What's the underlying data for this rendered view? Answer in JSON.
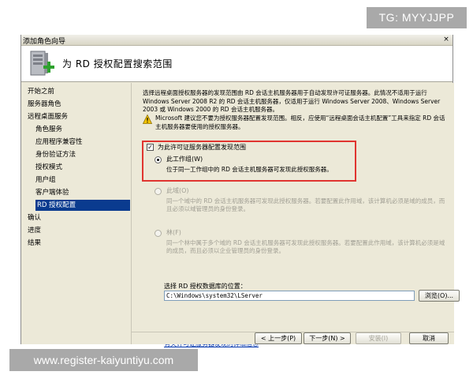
{
  "window": {
    "title": "添加角色向导",
    "close_glyph": "×"
  },
  "header": {
    "title": "为 RD 授权配置搜索范围",
    "icon": "server-add-icon"
  },
  "sidebar": {
    "items": [
      {
        "label": "开始之前",
        "level": 0,
        "active": false
      },
      {
        "label": "服务器角色",
        "level": 0,
        "active": false
      },
      {
        "label": "远程桌面服务",
        "level": 0,
        "active": false
      },
      {
        "label": "角色服务",
        "level": 1,
        "active": false
      },
      {
        "label": "应用程序兼容性",
        "level": 1,
        "active": false
      },
      {
        "label": "身份验证方法",
        "level": 1,
        "active": false
      },
      {
        "label": "授权模式",
        "level": 1,
        "active": false
      },
      {
        "label": "用户组",
        "level": 1,
        "active": false
      },
      {
        "label": "客户端体验",
        "level": 1,
        "active": false
      },
      {
        "label": "RD 授权配置",
        "level": 1,
        "active": true
      },
      {
        "label": "确认",
        "level": 0,
        "active": false
      },
      {
        "label": "进度",
        "level": 0,
        "active": false
      },
      {
        "label": "结果",
        "level": 0,
        "active": false
      }
    ]
  },
  "main": {
    "intro": "选择远程桌面授权服务器的发现范围由 RD 会话主机服务器用于自动发现许可证服务器。此情况不适用于运行 Windows Server 2008 R2 的 RD 会话主机服务器，仅适用于运行 Windows Server 2008、Windows Server 2003 或 Windows 2000 的 RD 会话主机服务器。",
    "warning": "Microsoft 建议您不要为授权服务器配置发现范围。相反，应使用“远程桌面会话主机配置”工具来指定 RD 会话主机服务器要使用的授权服务器。",
    "discovery_checkbox": {
      "label": "为此许可证服务器配置发现范围",
      "checked": true,
      "glyph": "✓"
    },
    "options": [
      {
        "label": "此工作组(W)",
        "desc": "位于同一工作组中的 RD 会话主机服务器可发现此授权服务器。",
        "selected": true,
        "enabled": true
      },
      {
        "label": "此域(O)",
        "desc": "同一个域中的 RD 会话主机服务器可发现此授权服务器。若要配置此作用域，该计算机必须是域的成员，而且必须以域管理员的身份登录。",
        "selected": false,
        "enabled": false
      },
      {
        "label": "林(F)",
        "desc": "同一个林中属于多个域的 RD 会话主机服务器可发现此授权服务器。若要配置此作用域，该计算机必须是域的成员，而且必须以企业管理员的身份登录。",
        "selected": false,
        "enabled": false
      }
    ],
    "db_location_label": "选择 RD 授权数据库的位置：",
    "db_location_value": "C:\\Windows\\system32\\LServer",
    "browse_button": "浏览(O)...",
    "help_link": "有关许可证服务器发现的详细信息"
  },
  "footer": {
    "back_button": "< 上一步(P)",
    "next_button": "下一步(N) >",
    "install_button": "安装(I)",
    "cancel_button": "取消"
  },
  "watermarks": {
    "top": "TG: MYYJJPP",
    "bottom": "www.register-kaiyuntiyu.com"
  },
  "colors": {
    "highlight_box": "#e03530",
    "active_nav": "#0a3b8f",
    "link": "#0033aa"
  }
}
